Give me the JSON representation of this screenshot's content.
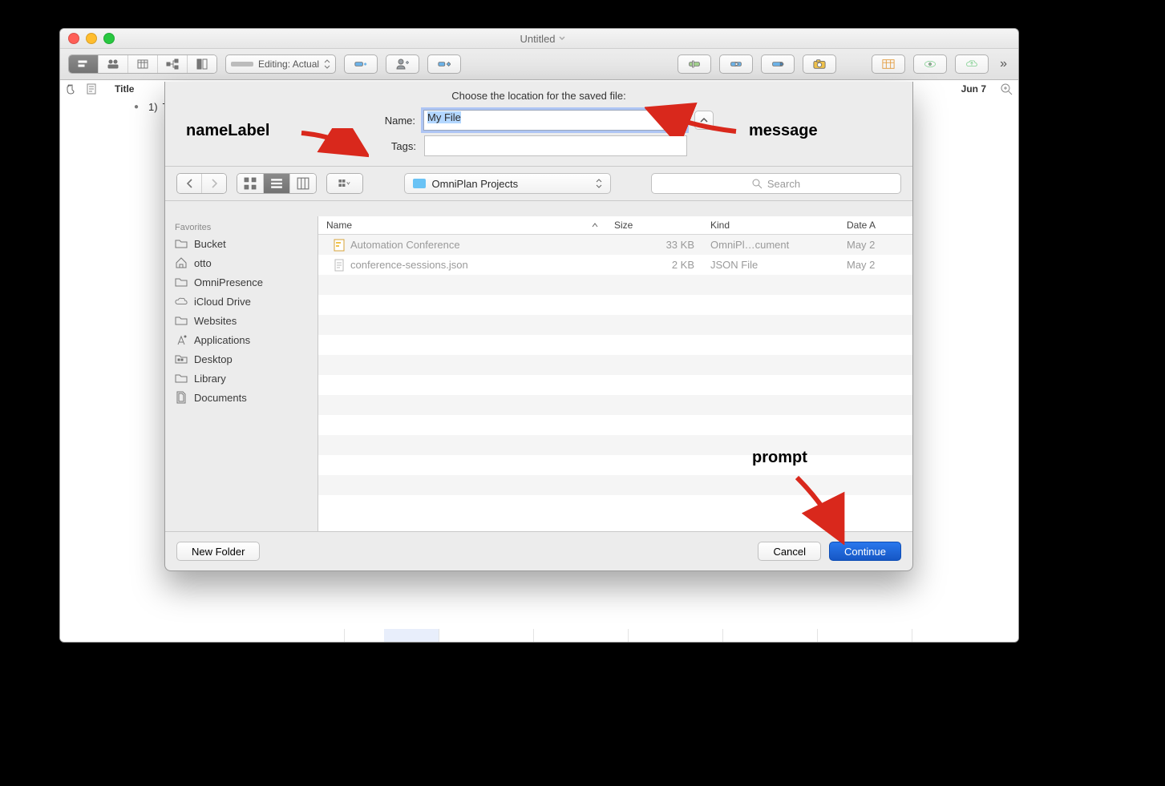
{
  "window": {
    "title": "Untitled"
  },
  "toolbar": {
    "editing_mode": "Editing: Actual"
  },
  "columns": {
    "title": "Title",
    "date": "Jun 7"
  },
  "outline": {
    "row1_index": "1)",
    "row1_text": "Task"
  },
  "annotations": {
    "nameLabel": "nameLabel",
    "message": "message",
    "prompt": "prompt"
  },
  "dialog": {
    "message": "Choose the location for the saved file:",
    "name_label": "Name:",
    "name_value": "My File",
    "tags_label": "Tags:",
    "location": "OmniPlan Projects",
    "search_placeholder": "Search",
    "sidebar_header": "Favorites",
    "sidebar": [
      {
        "label": "Bucket",
        "icon": "folder"
      },
      {
        "label": "otto",
        "icon": "home"
      },
      {
        "label": "OmniPresence",
        "icon": "folder"
      },
      {
        "label": "iCloud Drive",
        "icon": "cloud"
      },
      {
        "label": "Websites",
        "icon": "folder"
      },
      {
        "label": "Applications",
        "icon": "app"
      },
      {
        "label": "Desktop",
        "icon": "folder-grid"
      },
      {
        "label": "Library",
        "icon": "folder"
      },
      {
        "label": "Documents",
        "icon": "doc"
      }
    ],
    "file_columns": {
      "name": "Name",
      "size": "Size",
      "kind": "Kind",
      "date": "Date A"
    },
    "files": [
      {
        "name": "Automation Conference",
        "size": "33 KB",
        "kind": "OmniPl…cument",
        "date": "May 2"
      },
      {
        "name": "conference-sessions.json",
        "size": "2 KB",
        "kind": "JSON File",
        "date": "May 2"
      }
    ],
    "new_folder": "New Folder",
    "cancel": "Cancel",
    "continue": "Continue"
  }
}
